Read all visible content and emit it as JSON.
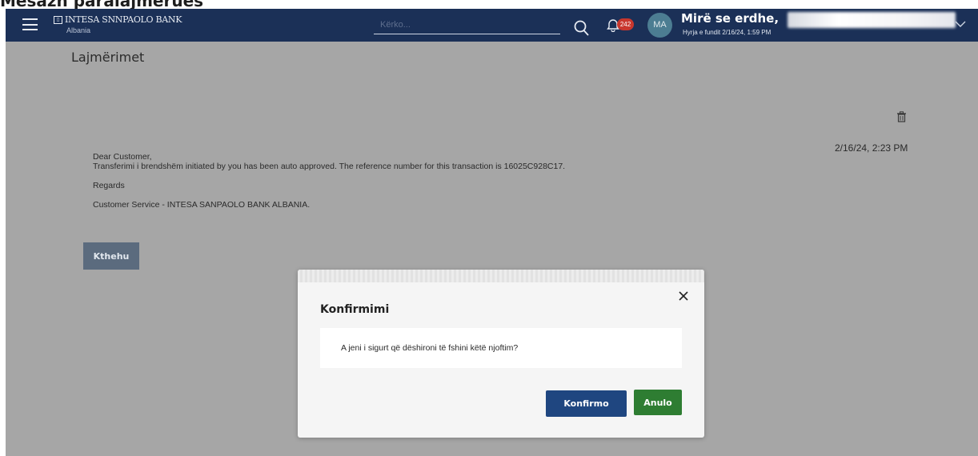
{
  "caption": "Mesazh paralajmërues",
  "header": {
    "bank_name": "INTESA SNNPAOLO BANK",
    "bank_country": "Albania",
    "search_placeholder": "Kërko...",
    "notification_count": "242",
    "avatar_initials": "MA",
    "greeting": "Mirë se erdhe,",
    "last_login": "Hyrja e fundit 2/16/24, 1:59 PM"
  },
  "page": {
    "title": "Lajmërimet"
  },
  "message": {
    "date": "2/16/24, 2:23 PM",
    "salutation": "Dear Customer,",
    "body": "Transferimi i brendshëm initiated by you has been auto approved. The reference number for this transaction is 16025C928C17.",
    "regards": "Regards",
    "signature": "Customer Service - INTESA SANPAOLO BANK ALBANIA.",
    "back_label": "Kthehu"
  },
  "dialog": {
    "title": "Konfirmimi",
    "text": "A jeni i sigurt që dëshironi të fshini këtë njoftim?",
    "confirm_label": "Konfirmo",
    "cancel_label": "Anulo"
  },
  "colors": {
    "header_bg": "#1b3057",
    "overlay_bg": "#a6a6a6",
    "confirm_bg": "#1f4680",
    "cancel_bg": "#2e7d32",
    "badge_bg": "#c8372d"
  },
  "icons": [
    "menu-icon",
    "bank-logo-icon",
    "search-icon",
    "bell-icon",
    "chevron-down-icon",
    "trash-icon",
    "close-icon"
  ]
}
